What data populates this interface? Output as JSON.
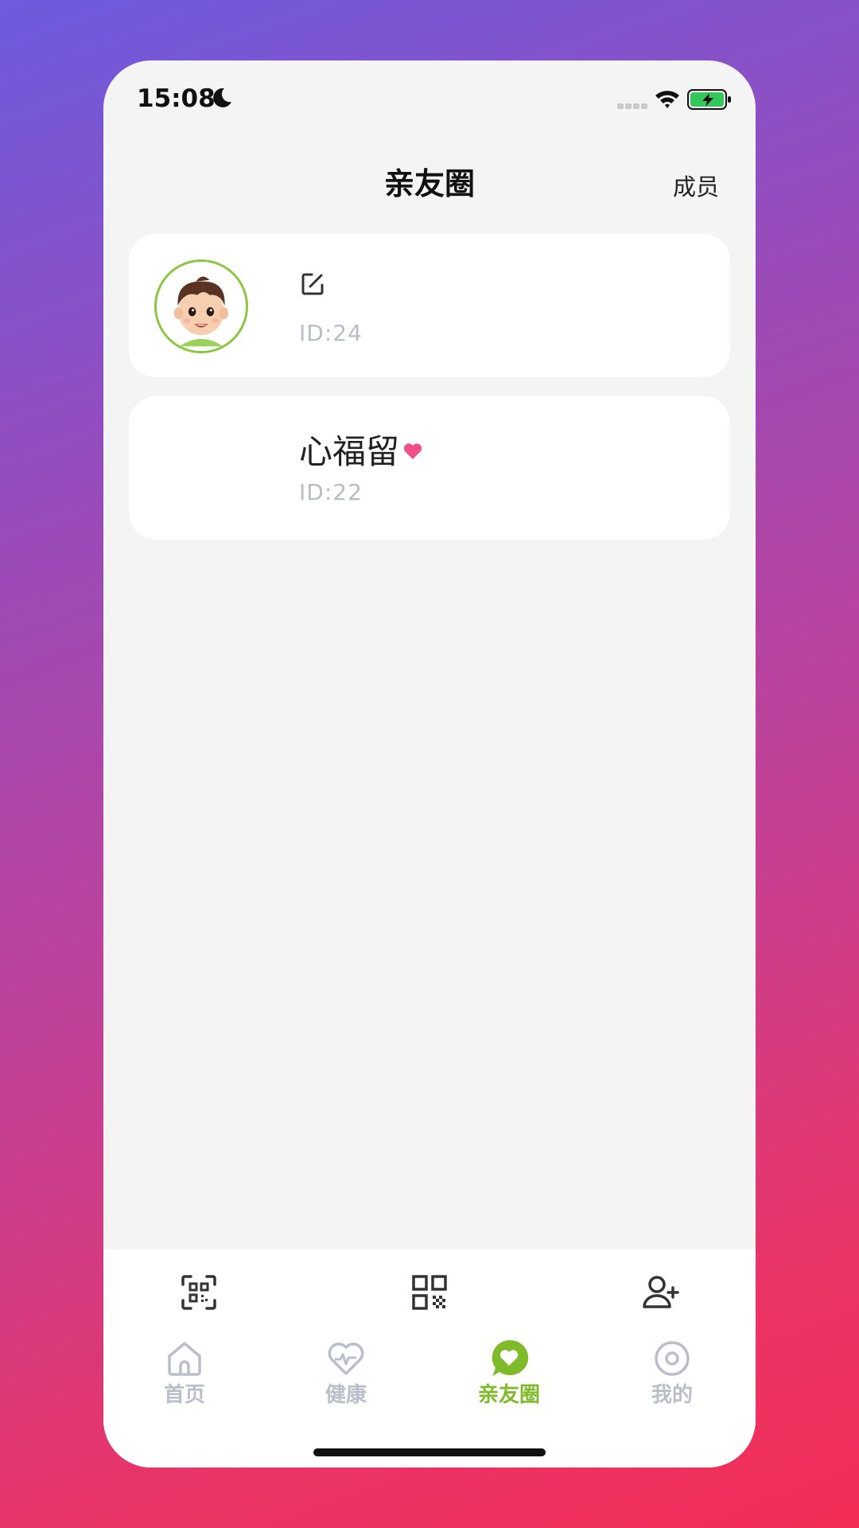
{
  "status_bar": {
    "time": "15:08"
  },
  "nav": {
    "title": "亲友圈",
    "members_label": "成员"
  },
  "cards": [
    {
      "id_label": "ID:24"
    },
    {
      "name": "心福留",
      "id_label": "ID:22"
    }
  ],
  "tabs": [
    {
      "label": "首页",
      "icon": "home-icon"
    },
    {
      "label": "健康",
      "icon": "heart-pulse-icon"
    },
    {
      "label": "亲友圈",
      "icon": "chat-heart-icon",
      "active": true
    },
    {
      "label": "我的",
      "icon": "profile-circle-icon"
    }
  ],
  "actions": [
    "scan-icon",
    "qr-code-icon",
    "add-user-icon"
  ],
  "colors": {
    "accent": "#7fba2a",
    "inactive": "#b9bfca",
    "heart": "#f04e8a"
  }
}
